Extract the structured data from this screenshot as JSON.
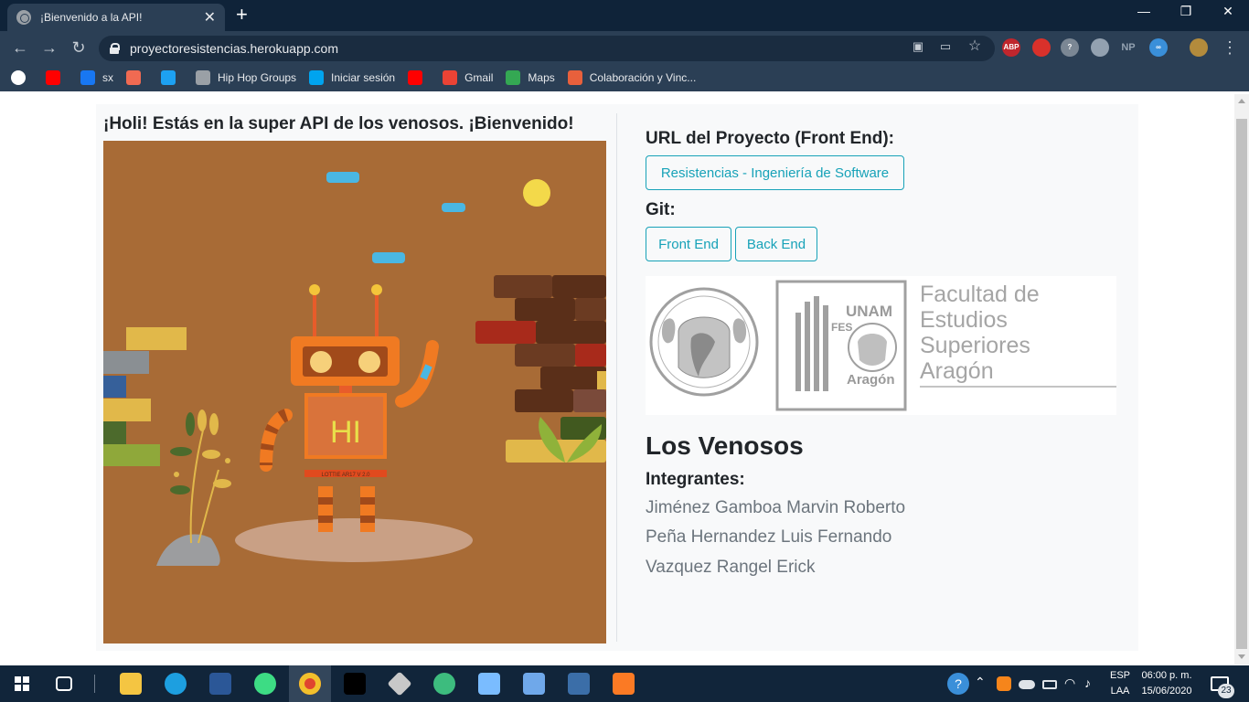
{
  "browser": {
    "tab_title": "¡Bienvenido a la API!",
    "tab_close": "✕",
    "new_tab": "+",
    "url": "proyectoresistencias.herokuapp.com",
    "window_controls": {
      "minimize": "—",
      "restore": "❐",
      "close": "✕"
    },
    "nav": {
      "back": "←",
      "forward": "→",
      "reload": "↻",
      "menu": "⋮"
    },
    "extensions": {
      "abp": "ABP",
      "np": "NP",
      "badge_count": "0"
    },
    "bookmarks": [
      {
        "label": "",
        "icon": "google-icon",
        "color": "#ffffff"
      },
      {
        "label": "",
        "icon": "youtube-icon",
        "color": "#ff0000"
      },
      {
        "label": "sx",
        "icon": "facebook-icon",
        "color": "#1877f2"
      },
      {
        "label": "",
        "icon": "app-icon",
        "color": "#f06a52"
      },
      {
        "label": "",
        "icon": "twitter-icon",
        "color": "#1da1f2"
      },
      {
        "label": "Hip Hop Groups",
        "icon": "globe-icon",
        "color": "#9aa0a6"
      },
      {
        "label": "Iniciar sesión",
        "icon": "microsoft-icon",
        "color": "#00a4ef"
      },
      {
        "label": "",
        "icon": "youtube-icon",
        "color": "#ff0000"
      },
      {
        "label": "Gmail",
        "icon": "gmail-icon",
        "color": "#ea4335"
      },
      {
        "label": "Maps",
        "icon": "maps-icon",
        "color": "#34a853"
      },
      {
        "label": "Colaboración y Vinc...",
        "icon": "site-icon",
        "color": "#e8603c"
      }
    ]
  },
  "page": {
    "welcome": "¡Holi! Estás en la super API de los venosos. ¡Bienvenido!",
    "robot_label": "HI",
    "robot_strip": "LOTTIE AR17 V 2.0",
    "url_heading": "URL del Proyecto (Front End):",
    "project_button": "Resistencias - Ingeniería de Software",
    "git_heading": "Git:",
    "front_button": "Front End",
    "back_button": "Back End",
    "logo": {
      "unam": "UNAM",
      "fes": "FES",
      "aragon_small": "Aragón",
      "line1": "Facultad de",
      "line2": "Estudios",
      "line3": "Superiores",
      "line4": "Aragón"
    },
    "team_name": "Los Venosos",
    "members_heading": "Integrantes:",
    "members": [
      "Jiménez Gamboa Marvin Roberto",
      "Peña Hernandez Luis Fernando",
      "Vazquez Rangel Erick"
    ]
  },
  "taskbar": {
    "language": "ESP",
    "layout": "LAA",
    "time": "06:00 p. m.",
    "date": "15/06/2020",
    "notifications": "23"
  }
}
